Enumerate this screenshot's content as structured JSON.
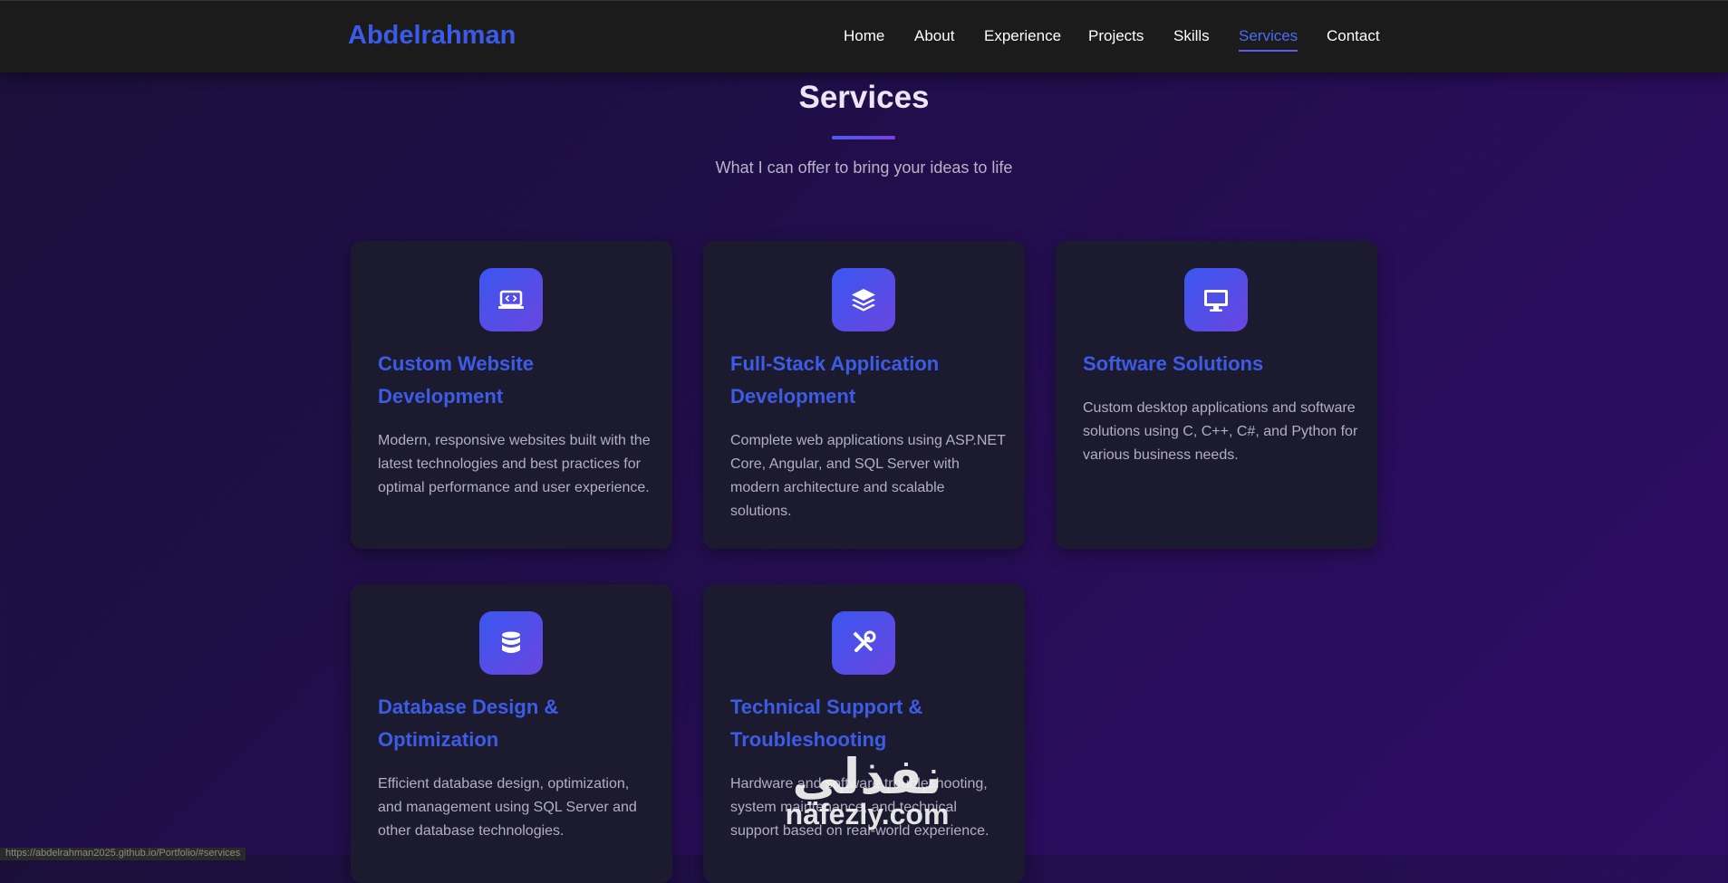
{
  "nav": {
    "logo": "Abdelrahman",
    "links": [
      "Home",
      "About",
      "Experience",
      "Projects",
      "Skills",
      "Services",
      "Contact"
    ],
    "active": "Services"
  },
  "section": {
    "title": "Services",
    "subtitle": "What I can offer to bring your ideas to life"
  },
  "cards": [
    {
      "icon": "laptop-code-icon",
      "title": "Custom Website Development",
      "description": "Modern, responsive websites built with the latest technologies and best practices for optimal performance and user experience."
    },
    {
      "icon": "layers-icon",
      "title": "Full-Stack Application Development",
      "description": "Complete web applications using ASP.NET Core, Angular, and SQL Server with modern architecture and scalable solutions."
    },
    {
      "icon": "desktop-icon",
      "title": "Software Solutions",
      "description": "Custom desktop applications and software solutions using C, C++, C#, and Python for various business needs."
    },
    {
      "icon": "database-icon",
      "title": "Database Design & Optimization",
      "description": "Efficient database design, optimization, and management using SQL Server and other database technologies."
    },
    {
      "icon": "tools-icon",
      "title": "Technical Support & Troubleshooting",
      "description": "Hardware and software troubleshooting, system maintenance, and technical support based on real-world experience."
    }
  ],
  "status_url": "https://abdelrahman2025.github.io/Portfolio/#services",
  "watermark": {
    "arabic": "نفذلي",
    "latin": "nafezly.com"
  },
  "colors": {
    "accent": "#3d5ce6",
    "nav_bg": "#1b1b1b",
    "card_bg": "#1c1a2e",
    "page_bg": "#220e4c"
  }
}
